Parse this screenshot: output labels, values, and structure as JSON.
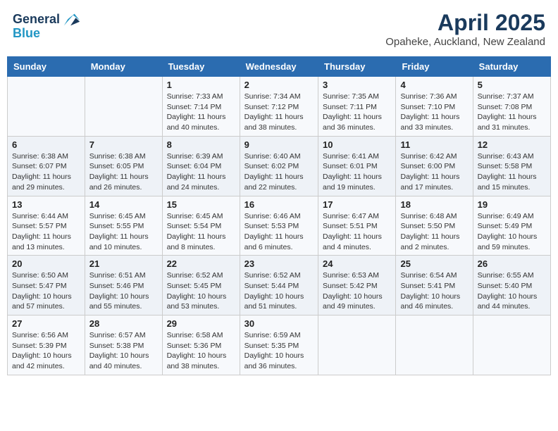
{
  "header": {
    "logo_line1": "General",
    "logo_line2": "Blue",
    "main_title": "April 2025",
    "subtitle": "Opaheke, Auckland, New Zealand"
  },
  "days_of_week": [
    "Sunday",
    "Monday",
    "Tuesday",
    "Wednesday",
    "Thursday",
    "Friday",
    "Saturday"
  ],
  "weeks": [
    [
      {
        "day": "",
        "info": ""
      },
      {
        "day": "",
        "info": ""
      },
      {
        "day": "1",
        "info": "Sunrise: 7:33 AM\nSunset: 7:14 PM\nDaylight: 11 hours and 40 minutes."
      },
      {
        "day": "2",
        "info": "Sunrise: 7:34 AM\nSunset: 7:12 PM\nDaylight: 11 hours and 38 minutes."
      },
      {
        "day": "3",
        "info": "Sunrise: 7:35 AM\nSunset: 7:11 PM\nDaylight: 11 hours and 36 minutes."
      },
      {
        "day": "4",
        "info": "Sunrise: 7:36 AM\nSunset: 7:10 PM\nDaylight: 11 hours and 33 minutes."
      },
      {
        "day": "5",
        "info": "Sunrise: 7:37 AM\nSunset: 7:08 PM\nDaylight: 11 hours and 31 minutes."
      }
    ],
    [
      {
        "day": "6",
        "info": "Sunrise: 6:38 AM\nSunset: 6:07 PM\nDaylight: 11 hours and 29 minutes."
      },
      {
        "day": "7",
        "info": "Sunrise: 6:38 AM\nSunset: 6:05 PM\nDaylight: 11 hours and 26 minutes."
      },
      {
        "day": "8",
        "info": "Sunrise: 6:39 AM\nSunset: 6:04 PM\nDaylight: 11 hours and 24 minutes."
      },
      {
        "day": "9",
        "info": "Sunrise: 6:40 AM\nSunset: 6:02 PM\nDaylight: 11 hours and 22 minutes."
      },
      {
        "day": "10",
        "info": "Sunrise: 6:41 AM\nSunset: 6:01 PM\nDaylight: 11 hours and 19 minutes."
      },
      {
        "day": "11",
        "info": "Sunrise: 6:42 AM\nSunset: 6:00 PM\nDaylight: 11 hours and 17 minutes."
      },
      {
        "day": "12",
        "info": "Sunrise: 6:43 AM\nSunset: 5:58 PM\nDaylight: 11 hours and 15 minutes."
      }
    ],
    [
      {
        "day": "13",
        "info": "Sunrise: 6:44 AM\nSunset: 5:57 PM\nDaylight: 11 hours and 13 minutes."
      },
      {
        "day": "14",
        "info": "Sunrise: 6:45 AM\nSunset: 5:55 PM\nDaylight: 11 hours and 10 minutes."
      },
      {
        "day": "15",
        "info": "Sunrise: 6:45 AM\nSunset: 5:54 PM\nDaylight: 11 hours and 8 minutes."
      },
      {
        "day": "16",
        "info": "Sunrise: 6:46 AM\nSunset: 5:53 PM\nDaylight: 11 hours and 6 minutes."
      },
      {
        "day": "17",
        "info": "Sunrise: 6:47 AM\nSunset: 5:51 PM\nDaylight: 11 hours and 4 minutes."
      },
      {
        "day": "18",
        "info": "Sunrise: 6:48 AM\nSunset: 5:50 PM\nDaylight: 11 hours and 2 minutes."
      },
      {
        "day": "19",
        "info": "Sunrise: 6:49 AM\nSunset: 5:49 PM\nDaylight: 10 hours and 59 minutes."
      }
    ],
    [
      {
        "day": "20",
        "info": "Sunrise: 6:50 AM\nSunset: 5:47 PM\nDaylight: 10 hours and 57 minutes."
      },
      {
        "day": "21",
        "info": "Sunrise: 6:51 AM\nSunset: 5:46 PM\nDaylight: 10 hours and 55 minutes."
      },
      {
        "day": "22",
        "info": "Sunrise: 6:52 AM\nSunset: 5:45 PM\nDaylight: 10 hours and 53 minutes."
      },
      {
        "day": "23",
        "info": "Sunrise: 6:52 AM\nSunset: 5:44 PM\nDaylight: 10 hours and 51 minutes."
      },
      {
        "day": "24",
        "info": "Sunrise: 6:53 AM\nSunset: 5:42 PM\nDaylight: 10 hours and 49 minutes."
      },
      {
        "day": "25",
        "info": "Sunrise: 6:54 AM\nSunset: 5:41 PM\nDaylight: 10 hours and 46 minutes."
      },
      {
        "day": "26",
        "info": "Sunrise: 6:55 AM\nSunset: 5:40 PM\nDaylight: 10 hours and 44 minutes."
      }
    ],
    [
      {
        "day": "27",
        "info": "Sunrise: 6:56 AM\nSunset: 5:39 PM\nDaylight: 10 hours and 42 minutes."
      },
      {
        "day": "28",
        "info": "Sunrise: 6:57 AM\nSunset: 5:38 PM\nDaylight: 10 hours and 40 minutes."
      },
      {
        "day": "29",
        "info": "Sunrise: 6:58 AM\nSunset: 5:36 PM\nDaylight: 10 hours and 38 minutes."
      },
      {
        "day": "30",
        "info": "Sunrise: 6:59 AM\nSunset: 5:35 PM\nDaylight: 10 hours and 36 minutes."
      },
      {
        "day": "",
        "info": ""
      },
      {
        "day": "",
        "info": ""
      },
      {
        "day": "",
        "info": ""
      }
    ]
  ]
}
